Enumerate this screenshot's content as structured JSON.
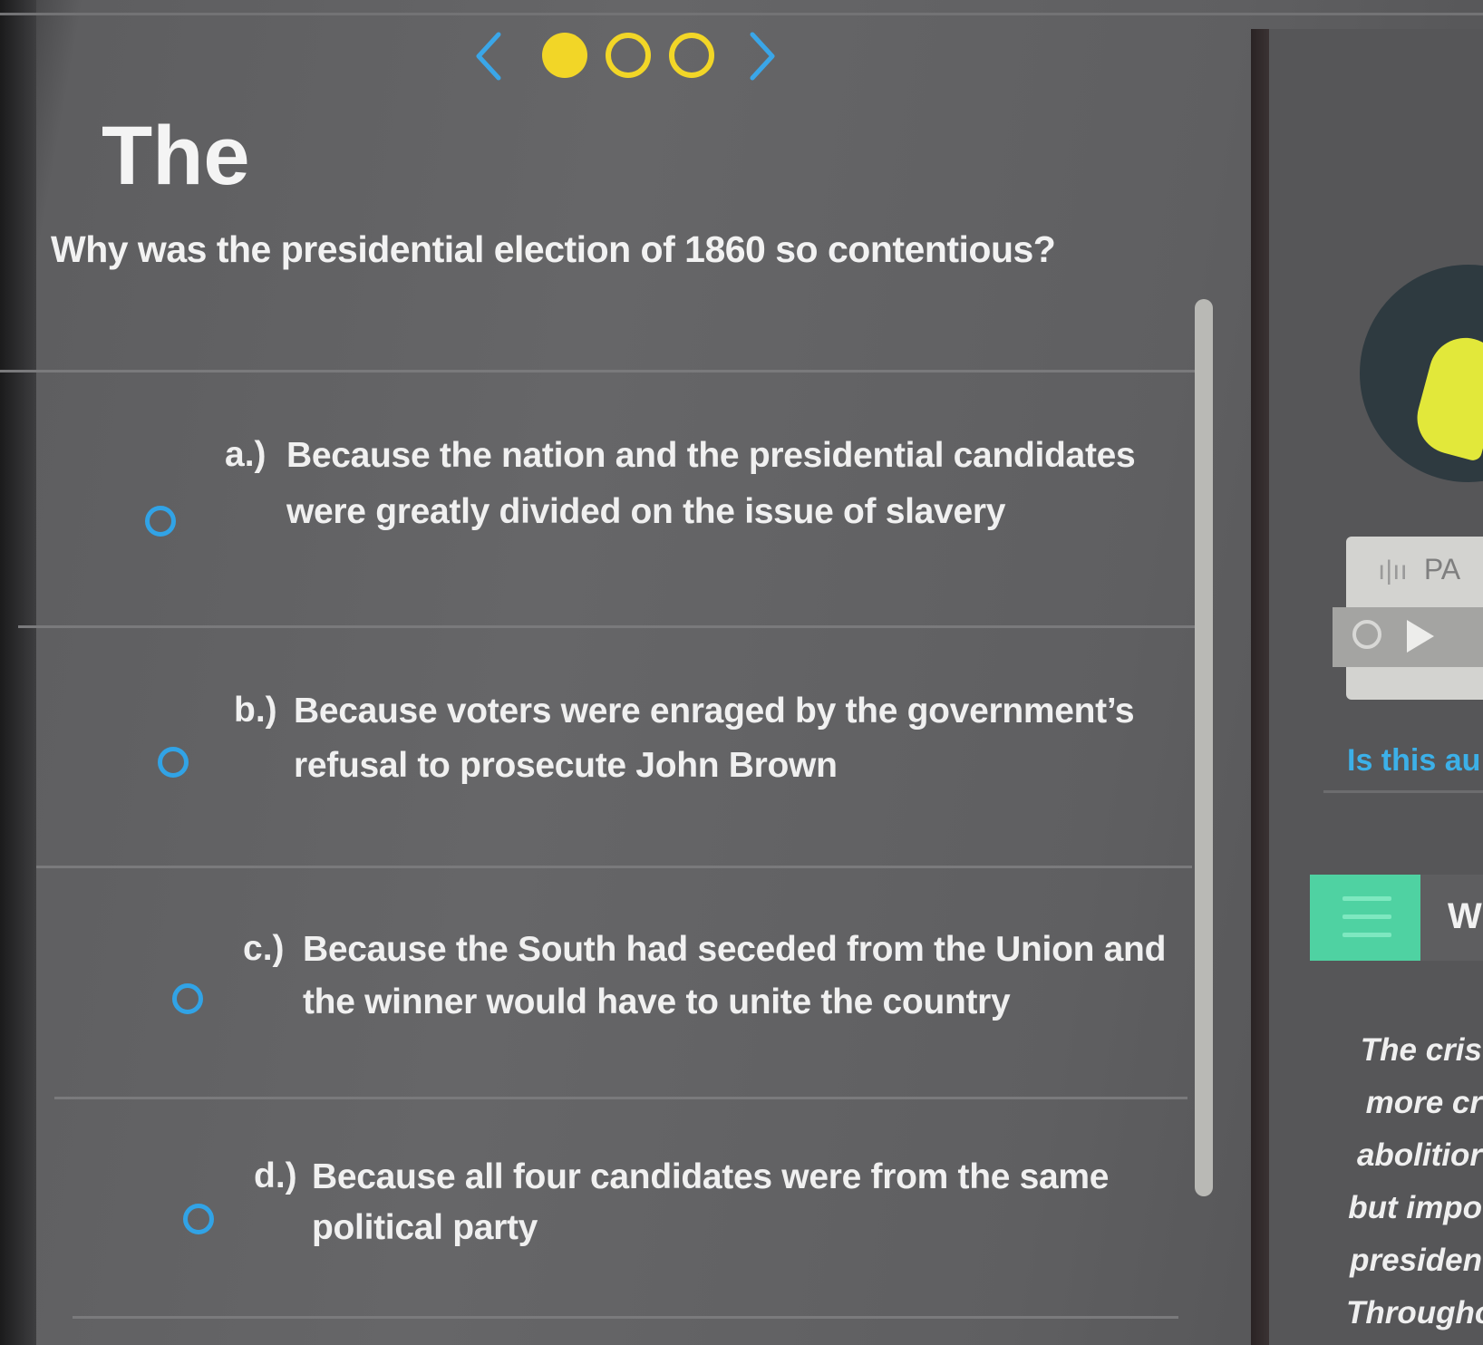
{
  "colors": {
    "accent_yellow": "#f2d627",
    "radio_blue": "#31a3e6",
    "link_blue": "#3cb0e8",
    "list_green": "#4fd2a2"
  },
  "nav": {
    "prev_icon": "chevron-left-icon",
    "next_icon": "chevron-right-icon",
    "dots": [
      {
        "state": "current"
      },
      {
        "state": "unanswered"
      },
      {
        "state": "unanswered"
      }
    ]
  },
  "question": {
    "text": "Why was the presidential election of 1860 so contentious?"
  },
  "options": [
    {
      "letter": "a.)",
      "line1": "Because the nation and the presidential candidates",
      "line2": "were greatly divided on the issue of slavery"
    },
    {
      "letter": "b.)",
      "line1": "Because voters were enraged by the government’s",
      "line2": "refusal to prosecute John Brown"
    },
    {
      "letter": "c.)",
      "line1": "Because the South had seceded from the Union and",
      "line2": "the winner would have to unite the country"
    },
    {
      "letter": "d.)",
      "line1": "Because all four candidates were from the same",
      "line2": "political party"
    }
  ],
  "right_panel": {
    "title": "The",
    "audio": {
      "label": "PA",
      "replay_icon": "replay-icon",
      "play_icon": "play-icon",
      "question": "Is this au"
    },
    "list_icon": "list-icon",
    "tab_letter": "W",
    "passage_lines": [
      "The cris",
      "more cr",
      "abolitior",
      "but impo",
      "presiden",
      "Througho"
    ]
  }
}
